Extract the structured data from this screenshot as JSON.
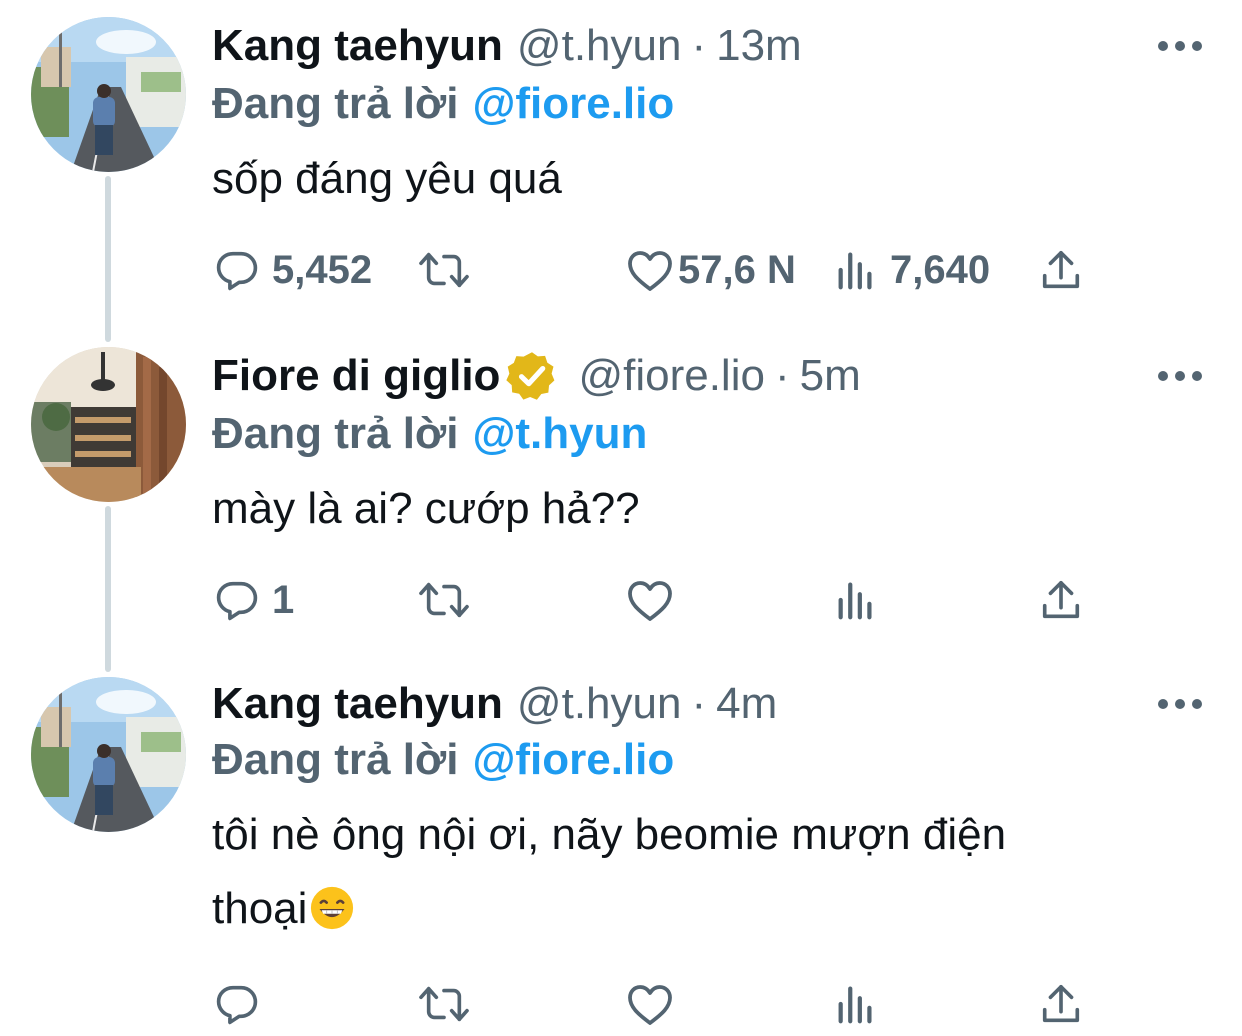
{
  "tweets": [
    {
      "name": "Kang taehyun",
      "handle": "@t.hyun",
      "separator": "·",
      "time": "13m",
      "replying_prefix": "Đang trả lời",
      "replying_to": "@fiore.lio",
      "text": "sốp đáng yêu quá",
      "replies": "5,452",
      "likes": "57,6 N",
      "views": "7,640",
      "verified": false,
      "avatar": "street-photo-avatar"
    },
    {
      "name": "Fiore di giglio",
      "handle": "@fiore.lio",
      "separator": "·",
      "time": "5m",
      "replying_prefix": "Đang trả lời",
      "replying_to": "@t.hyun",
      "text": "mày là ai? cướp hả??",
      "replies": "1",
      "verified": true,
      "avatar": "cafe-interior-avatar"
    },
    {
      "name": "Kang taehyun",
      "handle": "@t.hyun",
      "separator": "·",
      "time": "4m",
      "replying_prefix": "Đang trả lời",
      "replying_to": "@fiore.lio",
      "text_line1": "tôi nè ông nội ơi, nãy beomie mượn điện",
      "text_line2": "thoại",
      "emoji": "grinning-face-emoji",
      "verified": false,
      "avatar": "street-photo-avatar"
    }
  ],
  "icons": {
    "reply": "reply-icon",
    "retweet": "retweet-icon",
    "like": "like-icon",
    "views": "views-icon",
    "share": "share-icon",
    "more": "more-icon",
    "verified": "verified-badge-icon"
  },
  "colors": {
    "text": "#0f1419",
    "secondary": "#536471",
    "link": "#1d9bf0",
    "thread_line": "#cfd9de",
    "verified_gold": "#e2b719"
  }
}
